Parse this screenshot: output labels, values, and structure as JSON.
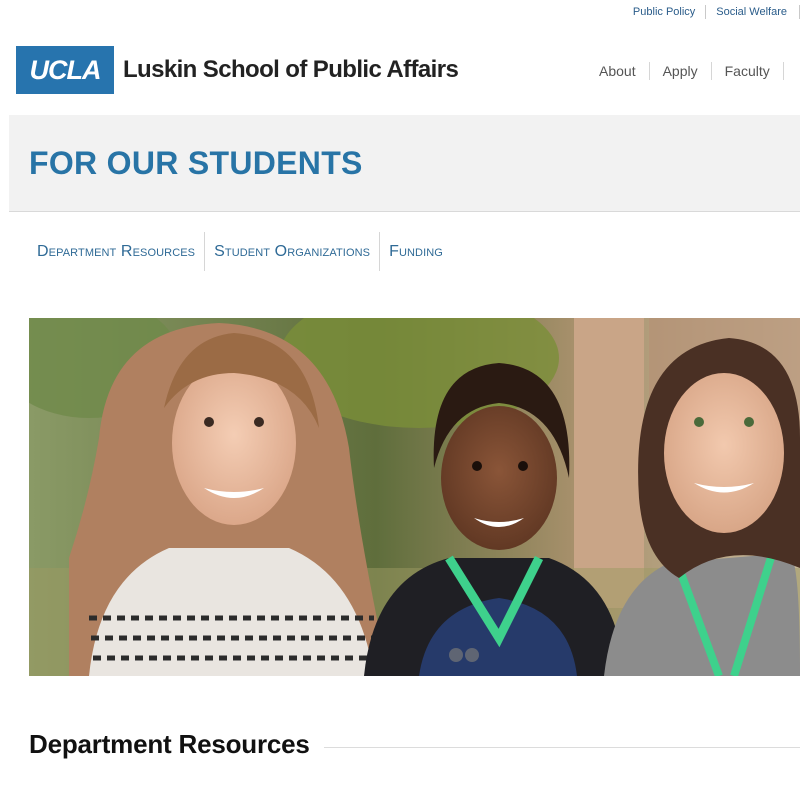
{
  "utility_nav": {
    "items": [
      "Public Policy",
      "Social Welfare"
    ]
  },
  "header": {
    "logo_text": "UCLA",
    "school_name": "Luskin School of Public Affairs",
    "nav": [
      "About",
      "Apply",
      "Faculty"
    ]
  },
  "page": {
    "title": "FOR OUR STUDENTS"
  },
  "sub_nav": {
    "items": [
      "Department Resources",
      "Student Organizations",
      "Funding"
    ]
  },
  "hero": {
    "carousel_dot_count": 2
  },
  "section": {
    "title": "Department Resources"
  },
  "colors": {
    "brand_blue": "#2774ae",
    "title_blue": "#2874a6",
    "link_blue": "#2f6a96",
    "band_gray": "#f2f2f2"
  }
}
